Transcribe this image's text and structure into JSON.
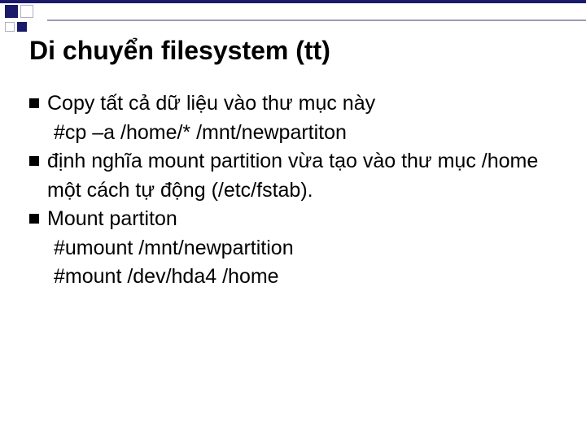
{
  "title": "Di chuyển filesystem (tt)",
  "items": [
    {
      "text": "Copy tất cả dữ liệu vào thư mục này",
      "subs": [
        "#cp  –a  /home/*  /mnt/newpartiton"
      ]
    },
    {
      "text": "định nghĩa mount partition vừa tạo vào thư mục /home một cách tự động (/etc/fstab).",
      "subs": []
    },
    {
      "text": "Mount partiton",
      "subs": [
        "#umount  /mnt/newpartition",
        "#mount  /dev/hda4  /home"
      ]
    }
  ]
}
